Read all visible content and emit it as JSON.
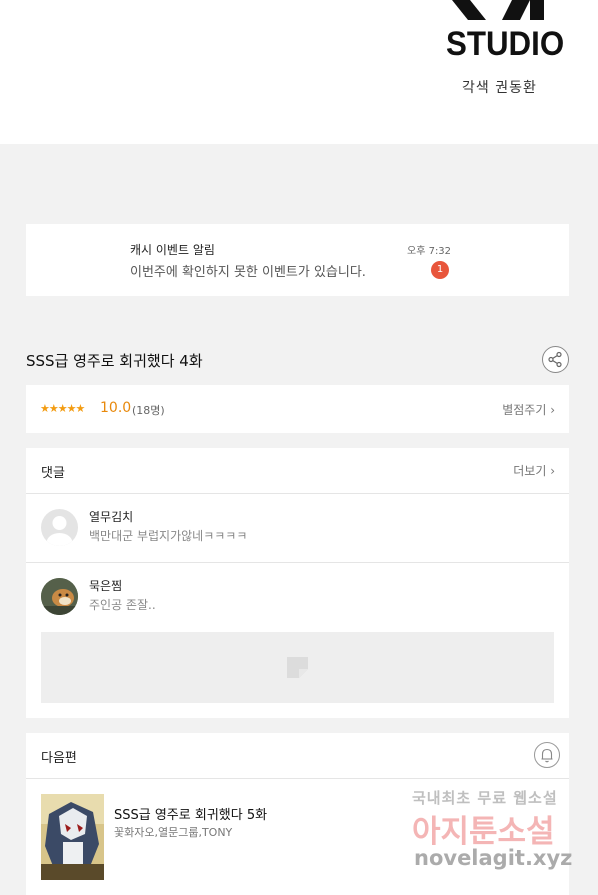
{
  "banner": {
    "logo_text": "STUDIO",
    "credit": "각색 권동환"
  },
  "notice": {
    "title": "캐시 이벤트 알림",
    "body": "이번주에 확인하지 못한 이벤트가 있습니다.",
    "time": "오후 7:32",
    "badge_count": "1",
    "badge_color": "#e8553b"
  },
  "episode": {
    "title": "SSS급 영주로 회귀했다 4화",
    "share_icon": "share-icon"
  },
  "rating": {
    "stars": "★★★★★",
    "score": "10.0",
    "count": "(18명)",
    "rate_link": "별점주기 ›",
    "accent_color": "#e8890c"
  },
  "comments": {
    "header": "댓글",
    "more_link": "더보기 ›",
    "items": [
      {
        "name": "열무김치",
        "text": "백만대군 부럽지가않네ㅋㅋㅋㅋ"
      },
      {
        "name": "묵은찜",
        "text": "주인공 존잘.."
      }
    ]
  },
  "next": {
    "header": "다음편",
    "bell_icon": "bell-icon",
    "title": "SSS급 영주로 회귀했다 5화",
    "authors": "꽃화자오,열문그룹,TONY"
  },
  "watermark": {
    "line1": "국내최초 무료 웹소설",
    "line2": "아지툰소설",
    "line3": "novelagit.xyz"
  }
}
